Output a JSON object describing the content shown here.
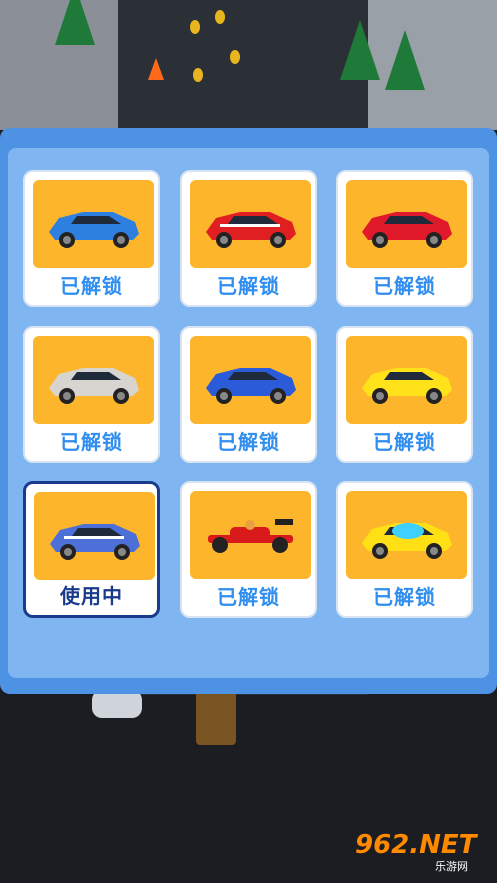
{
  "cards": [
    {
      "label": "已解锁",
      "car": "blue-muscle-car",
      "color": "#2d7fe0",
      "accent": "#1a5ab5",
      "state": "unlocked"
    },
    {
      "label": "已解锁",
      "car": "red-muscle-car",
      "color": "#e02020",
      "accent": "#ffffff",
      "state": "unlocked"
    },
    {
      "label": "已解锁",
      "car": "red-sports-car",
      "color": "#e01a2a",
      "accent": "#a0101a",
      "state": "unlocked"
    },
    {
      "label": "已解锁",
      "car": "silver-supercar",
      "color": "#d8d4d0",
      "accent": "#c9a070",
      "state": "unlocked"
    },
    {
      "label": "已解锁",
      "car": "blue-coupe",
      "color": "#2a5bd8",
      "accent": "#1a3a9a",
      "state": "unlocked"
    },
    {
      "label": "已解锁",
      "car": "yellow-supercar",
      "color": "#ffe21a",
      "accent": "#222222",
      "state": "unlocked"
    },
    {
      "label": "使用中",
      "car": "blue-classic-car",
      "color": "#4d6fd8",
      "accent": "#ffffff",
      "state": "in-use"
    },
    {
      "label": "已解锁",
      "car": "red-formula-car",
      "color": "#d81a1a",
      "accent": "#222222",
      "state": "unlocked"
    },
    {
      "label": "已解锁",
      "car": "yellow-futuristic-car",
      "color": "#ffe014",
      "accent": "#3fd0ff",
      "state": "unlocked"
    }
  ],
  "watermark": {
    "brand": "962.NET",
    "sub": "乐游网"
  }
}
